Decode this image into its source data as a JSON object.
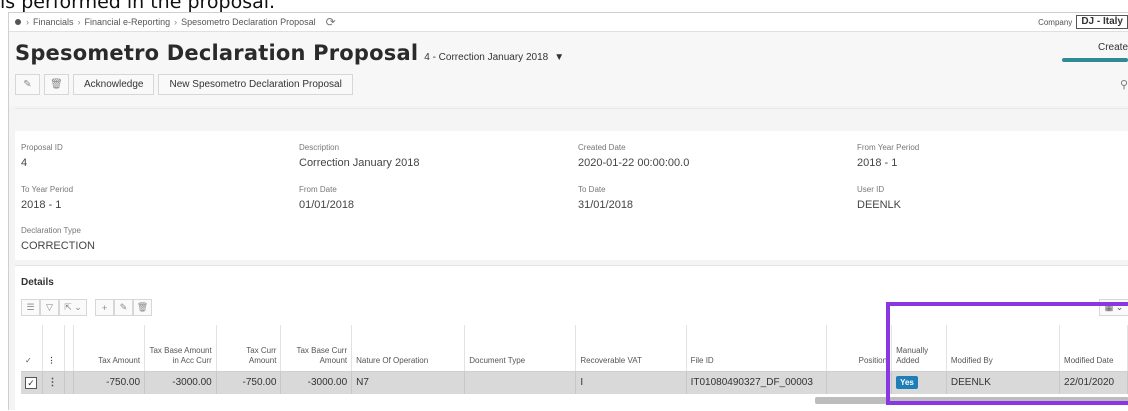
{
  "caption_text": "is performed in the proposal.",
  "breadcrumb": [
    "Financials",
    "Financial e-Reporting",
    "Spesometro Declaration Proposal"
  ],
  "company": {
    "label": "Company",
    "value": "DJ - Italy"
  },
  "page": {
    "title": "Spesometro Declaration Proposal",
    "subtitle": "4 - Correction January 2018",
    "create_label": "Create"
  },
  "toolbar": {
    "acknowledge_label": "Acknowledge",
    "new_proposal_label": "New Spesometro Declaration Proposal"
  },
  "fields": {
    "proposal_id": {
      "label": "Proposal ID",
      "value": "4"
    },
    "description": {
      "label": "Description",
      "value": "Correction January 2018"
    },
    "created_date": {
      "label": "Created Date",
      "value": "2020-01-22 00:00:00.0"
    },
    "from_year_period": {
      "label": "From Year Period",
      "value": "2018 - 1"
    },
    "to_year_period": {
      "label": "To Year Period",
      "value": "2018 - 1"
    },
    "from_date": {
      "label": "From Date",
      "value": "01/01/2018"
    },
    "to_date": {
      "label": "To Date",
      "value": "31/01/2018"
    },
    "user_id": {
      "label": "User ID",
      "value": "DEENLK"
    },
    "declaration_type": {
      "label": "Declaration Type",
      "value": "CORRECTION"
    }
  },
  "details": {
    "title": "Details",
    "columns": {
      "tax_amount": "Tax Amount",
      "tax_base_amount_acc": "Tax Base Amount in Acc Curr",
      "tax_curr_amount": "Tax Curr Amount",
      "tax_base_curr_amount": "Tax Base Curr Amount",
      "nature_of_operation": "Nature Of Operation",
      "document_type": "Document Type",
      "recoverable_vat": "Recoverable VAT",
      "file_id": "File ID",
      "position": "Position",
      "manually_added": "Manually Added",
      "modified_by": "Modified By",
      "modified_date": "Modified Date"
    },
    "row": {
      "tax_amount": "-750.00",
      "tax_base_amount_acc": "-3000.00",
      "tax_curr_amount": "-750.00",
      "tax_base_curr_amount": "-3000.00",
      "nature_of_operation": "N7",
      "document_type": "",
      "recoverable_vat": "I",
      "file_id": "IT01080490327_DF_00003",
      "position": "",
      "manually_added": "Yes",
      "modified_by": "DEENLK",
      "modified_date": "22/01/2020"
    }
  },
  "colors": {
    "highlight": "#8a36e1",
    "yes_badge": "#1f7eb8",
    "create_bar": "#2f8a94"
  }
}
